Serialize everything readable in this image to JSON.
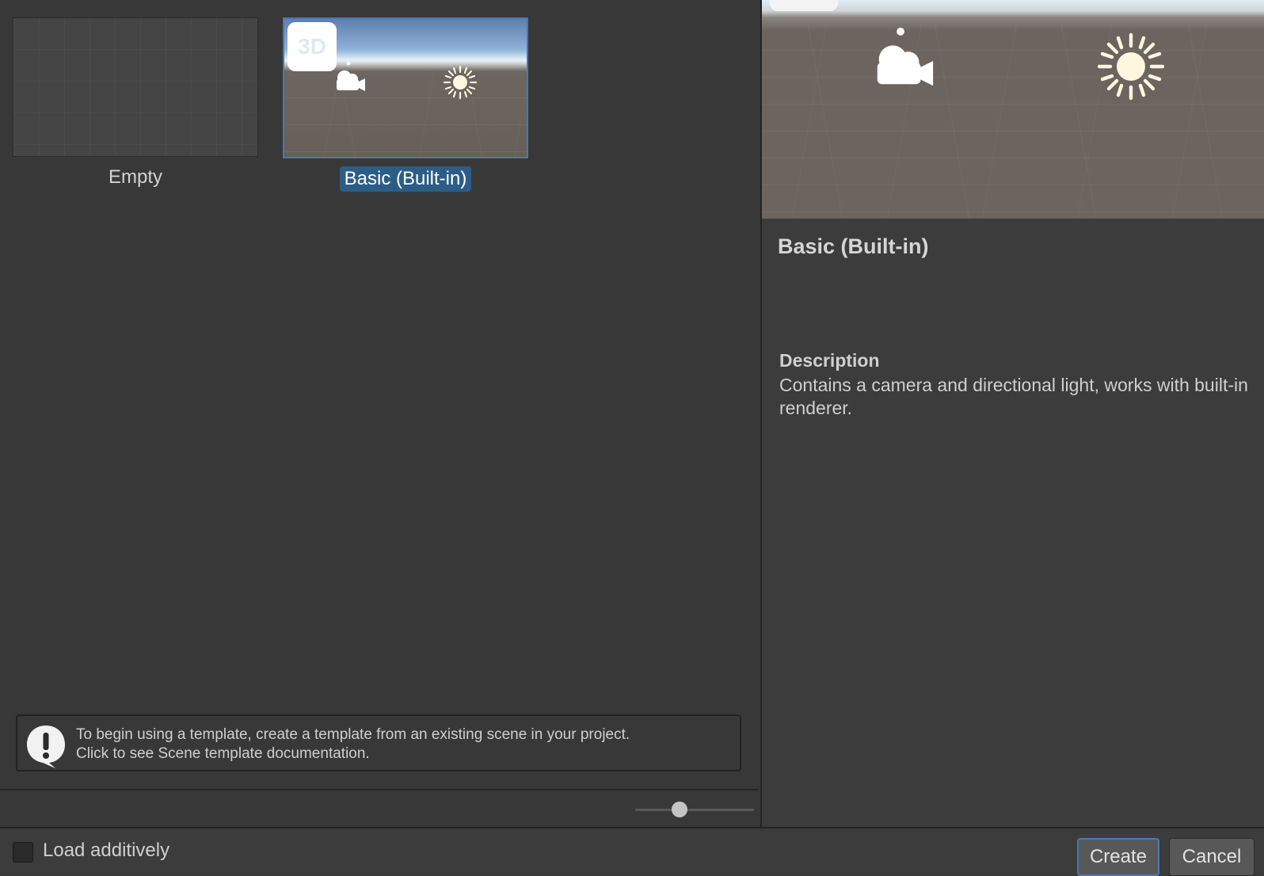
{
  "templates": [
    {
      "label": "Empty",
      "selected": false
    },
    {
      "label": "Basic (Built-in)",
      "selected": true,
      "badge": "3D"
    }
  ],
  "details": {
    "title": "Basic (Built-in)",
    "description_heading": "Description",
    "description_text": "Contains a camera and directional light, works with built-in renderer."
  },
  "info": {
    "line1": "To begin using a template, create a template from an existing scene in your project.",
    "line2": "Click to see Scene template documentation."
  },
  "zoom": {
    "value": 0.35
  },
  "footer": {
    "load_additively_label": "Load additively",
    "load_additively_checked": false,
    "create_label": "Create",
    "cancel_label": "Cancel"
  },
  "colors": {
    "selection": "#2c5d87",
    "accent_border": "#4a78b4"
  }
}
